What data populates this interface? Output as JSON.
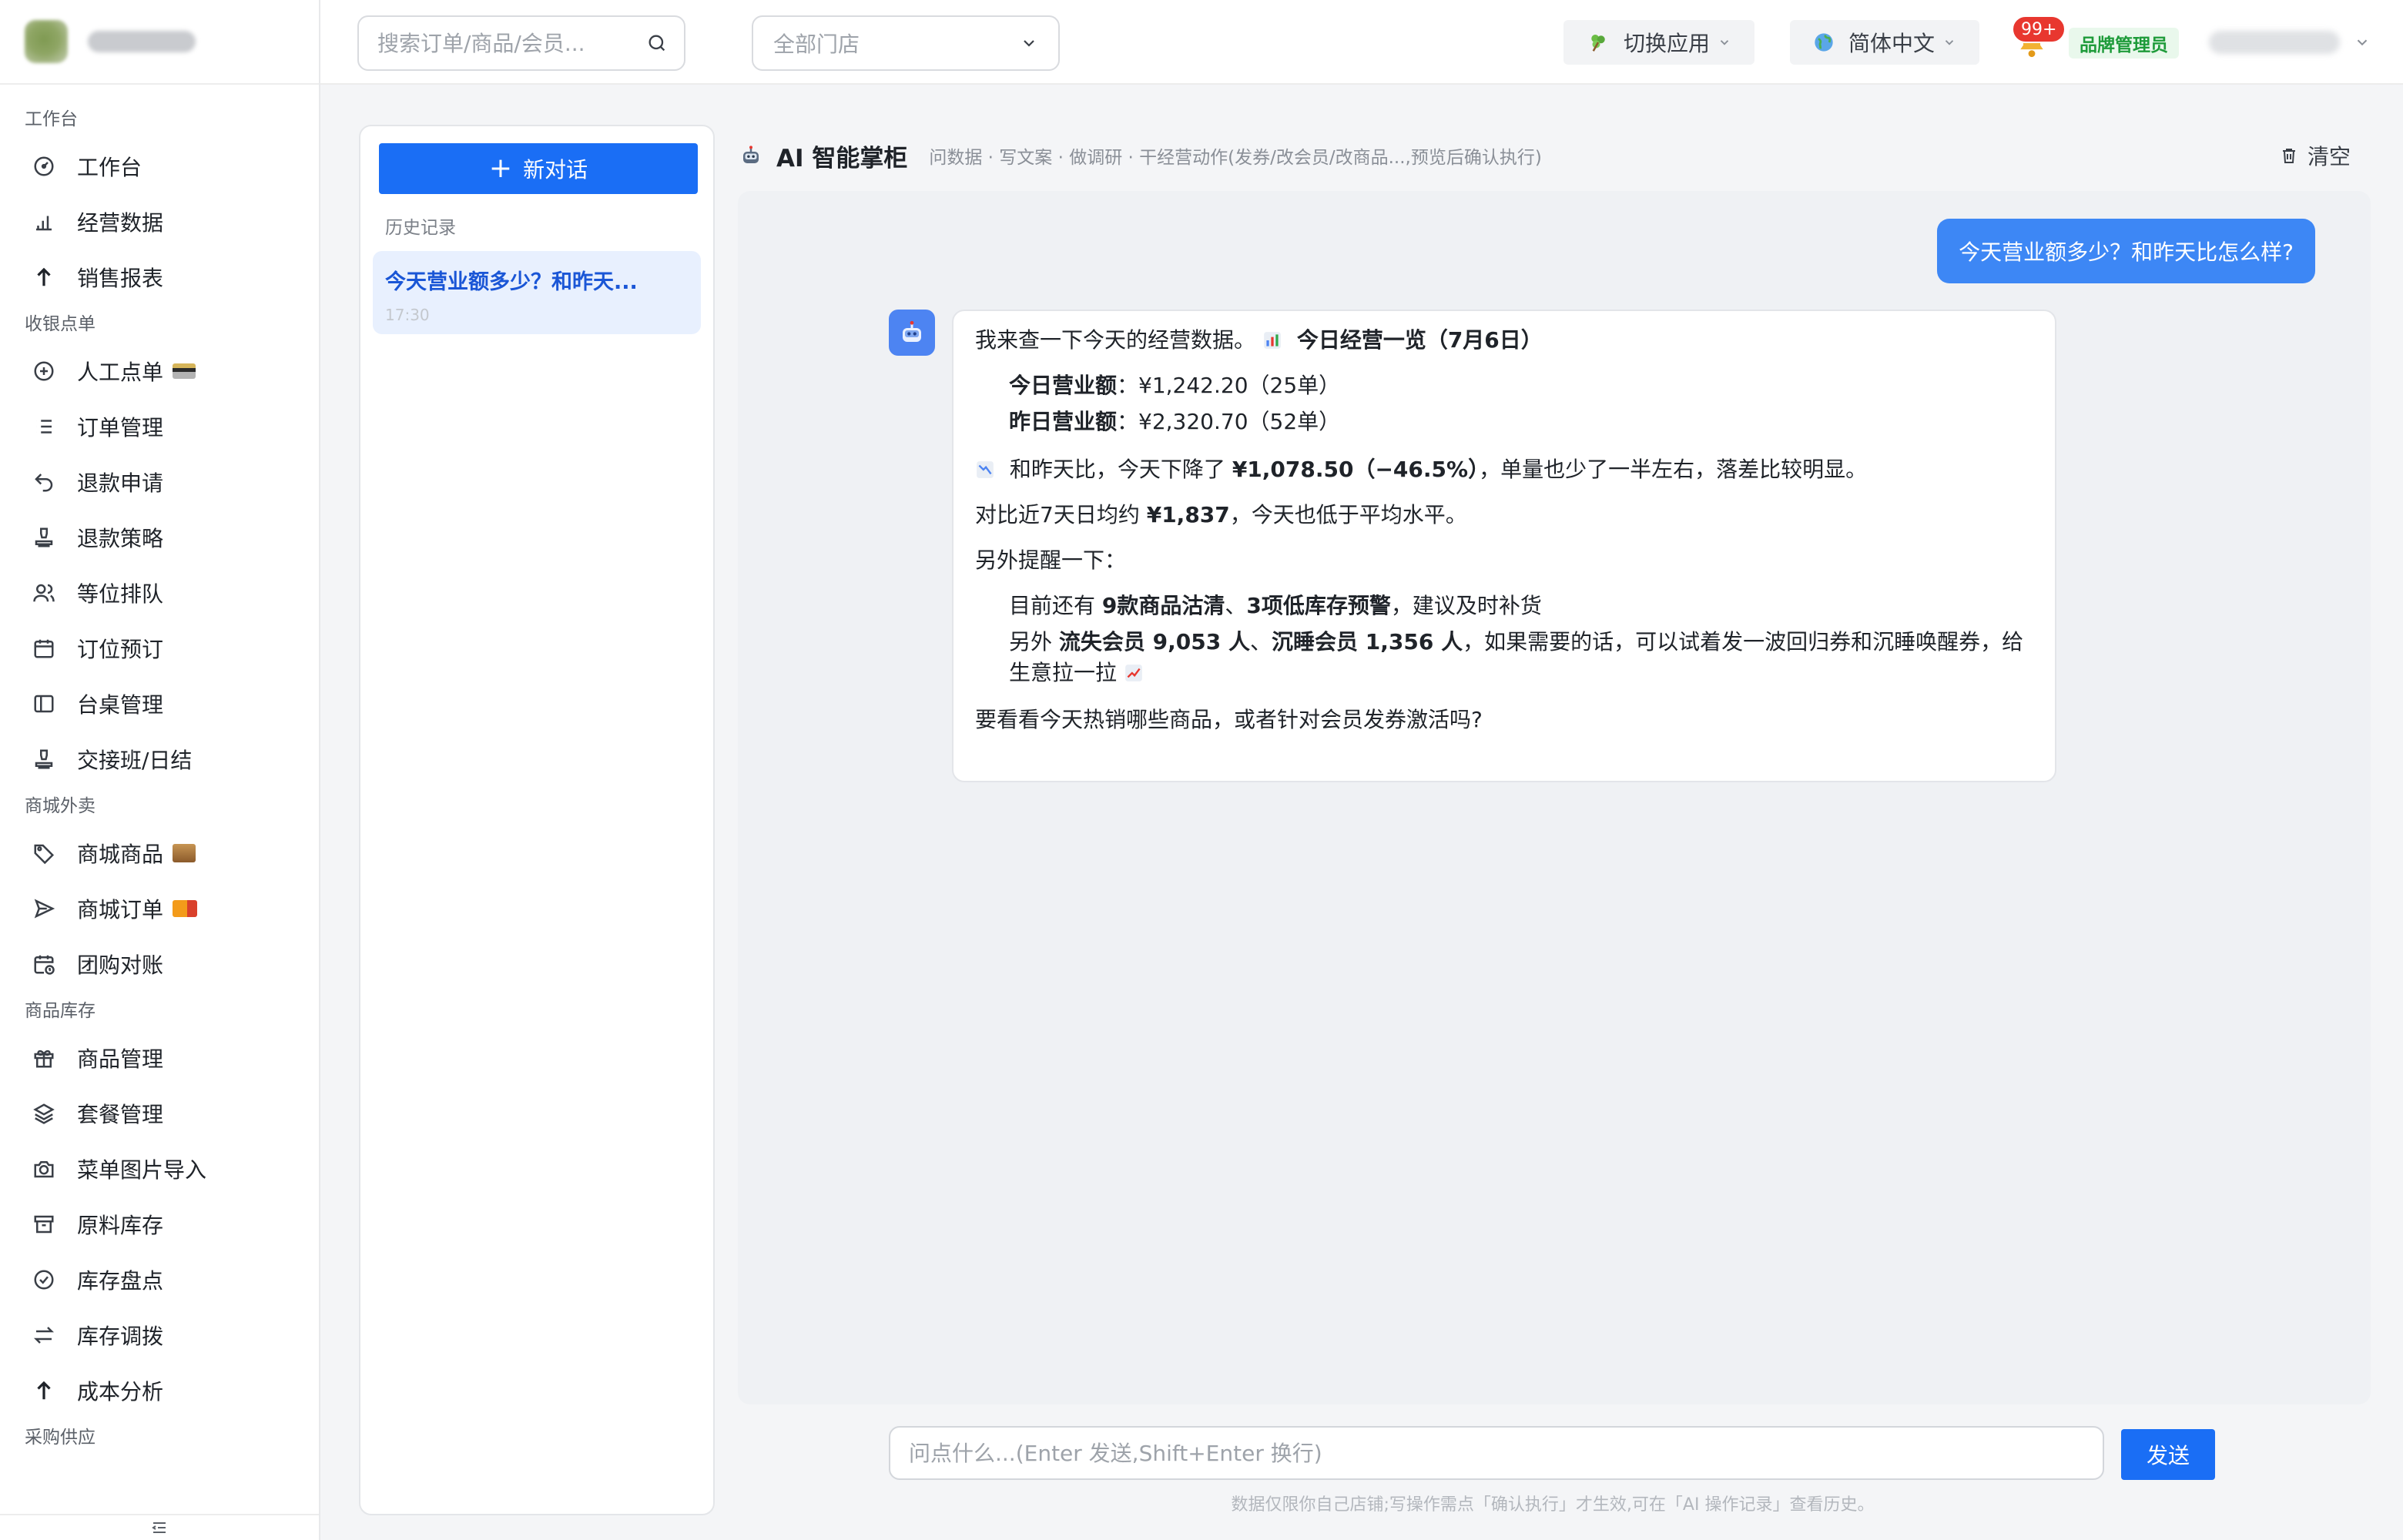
{
  "header": {
    "search_placeholder": "搜索订单/商品/会员...",
    "store_select": "全部门店",
    "switch_app": "切换应用",
    "language": "简体中文",
    "notifications": "99+",
    "role": "品牌管理员"
  },
  "sidebar": {
    "groups": [
      {
        "title": "工作台",
        "items": [
          {
            "label": "工作台",
            "icon": "dashboard-icon"
          },
          {
            "label": "经营数据",
            "icon": "bar-chart-icon"
          },
          {
            "label": "销售报表",
            "icon": "arrow-up-icon"
          }
        ]
      },
      {
        "title": "收银点单",
        "items": [
          {
            "label": "人工点单",
            "icon": "plus-circle-icon"
          },
          {
            "label": "订单管理",
            "icon": "list-icon"
          },
          {
            "label": "退款申请",
            "icon": "undo-icon"
          },
          {
            "label": "退款策略",
            "icon": "stamp-icon"
          },
          {
            "label": "等位排队",
            "icon": "users-icon"
          },
          {
            "label": "订位预订",
            "icon": "calendar-icon"
          },
          {
            "label": "台桌管理",
            "icon": "sidebar-panel-icon"
          },
          {
            "label": "交接班/日结",
            "icon": "stamp-icon"
          }
        ]
      },
      {
        "title": "商城外卖",
        "items": [
          {
            "label": "商城商品",
            "icon": "tag-icon"
          },
          {
            "label": "商城订单",
            "icon": "send-icon"
          },
          {
            "label": "团购对账",
            "icon": "calendar-clock-icon"
          }
        ]
      },
      {
        "title": "商品库存",
        "items": [
          {
            "label": "商品管理",
            "icon": "gift-icon"
          },
          {
            "label": "套餐管理",
            "icon": "layers-icon"
          },
          {
            "label": "菜单图片导入",
            "icon": "camera-icon"
          },
          {
            "label": "原料库存",
            "icon": "archive-icon"
          },
          {
            "label": "库存盘点",
            "icon": "check-circle-icon"
          },
          {
            "label": "库存调拨",
            "icon": "swap-icon"
          },
          {
            "label": "成本分析",
            "icon": "arrow-up-icon"
          }
        ]
      },
      {
        "title": "采购供应",
        "items": []
      }
    ]
  },
  "history": {
    "new_chat": "新对话",
    "title": "历史记录",
    "items": [
      {
        "text": "今天营业额多少？和昨天...",
        "time": "17:30"
      }
    ]
  },
  "chat": {
    "title": "AI 智能掌柜",
    "subtitle": "问数据 · 写文案 · 做调研 · 干经营动作(发券/改会员/改商品...,预览后确认执行)",
    "clear": "清空",
    "user_message": "今天营业额多少？和昨天比怎么样?",
    "bot": {
      "intro": "我来查一下今天的经营数据。",
      "overview": "今日经营一览（7月6日）",
      "today_label": "今日营业额",
      "today_value": "：¥1,242.20（25单）",
      "yesterday_label": "昨日营业额",
      "yesterday_value": "：¥2,320.70（52单）",
      "compare_pre": "和昨天比，今天下降了 ",
      "compare_bold": "¥1,078.50（−46.5%）",
      "compare_post": "，单量也少了一半左右，落差比较明显。",
      "avg_pre": "对比近7天日均约 ",
      "avg_bold": "¥1,837",
      "avg_post": "，今天也低于平均水平。",
      "remind": "另外提醒一下：",
      "stock_pre": "目前还有 ",
      "stock_bold1": "9款商品沽清",
      "stock_sep": "、",
      "stock_bold2": "3项低库存预警",
      "stock_post": "，建议及时补货",
      "member_pre": "另外 ",
      "member_bold1": "流失会员 9,053 人",
      "member_sep": "、",
      "member_bold2": "沉睡会员 1,356 人",
      "member_post": "，如果需要的话，可以试着发一波回归券和沉睡唤醒券，给生意拉一拉",
      "question": "要看看今天热销哪些商品，或者针对会员发券激活吗?"
    },
    "input_placeholder": "问点什么...(Enter 发送,Shift+Enter 换行)",
    "send": "发送",
    "disclaimer": "数据仅限你自己店铺;写操作需点「确认执行」才生效,可在「AI 操作记录」查看历史。"
  },
  "colors": {
    "primary": "#1a6ef5",
    "user_bubble": "#3d87f5",
    "badge_red": "#e8372f",
    "role_green": "#1e9b3a"
  }
}
